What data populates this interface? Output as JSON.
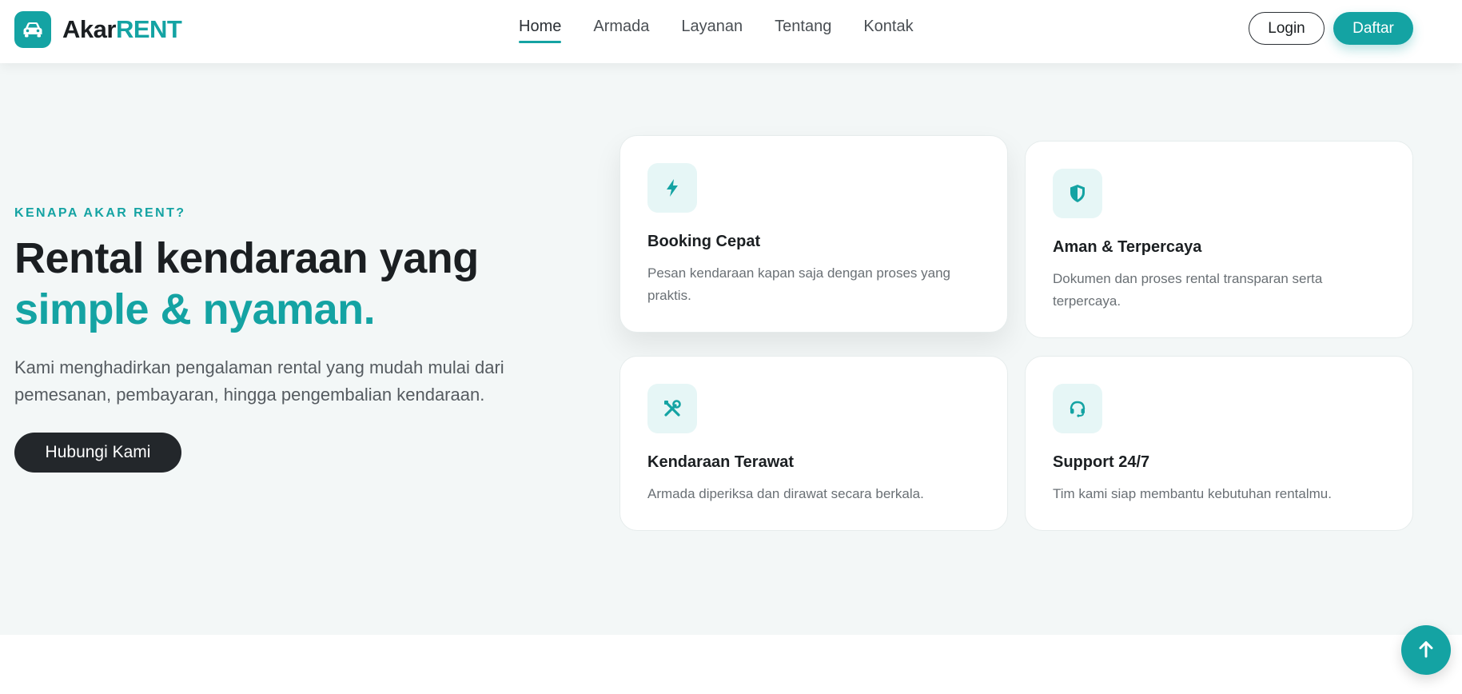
{
  "brand": {
    "name_part1": "Akar",
    "name_part2": "RENT",
    "icon": "car-icon"
  },
  "nav": {
    "items": [
      {
        "label": "Home",
        "active": true
      },
      {
        "label": "Armada",
        "active": false
      },
      {
        "label": "Layanan",
        "active": false
      },
      {
        "label": "Tentang",
        "active": false
      },
      {
        "label": "Kontak",
        "active": false
      }
    ],
    "login_label": "Login",
    "signup_label": "Daftar"
  },
  "hero": {
    "eyebrow": "KENAPA AKAR RENT?",
    "headline_line1": "Rental kendaraan yang",
    "headline_line2": "simple & nyaman.",
    "lead": "Kami menghadirkan pengalaman rental yang mudah mulai dari pemesanan, pembayaran, hingga pengembalian kendaraan.",
    "cta_label": "Hubungi Kami"
  },
  "features": [
    {
      "icon": "lightning-icon",
      "title": "Booking Cepat",
      "desc": "Pesan kendaraan kapan saja dengan proses yang praktis."
    },
    {
      "icon": "shield-icon",
      "title": "Aman & Terpercaya",
      "desc": "Dokumen dan proses rental transparan serta terpercaya."
    },
    {
      "icon": "tools-icon",
      "title": "Kendaraan Terawat",
      "desc": "Armada diperiksa dan dirawat secara berkala."
    },
    {
      "icon": "headset-icon",
      "title": "Support 24/7",
      "desc": "Tim kami siap membantu kebutuhan rentalmu."
    }
  ],
  "colors": {
    "accent": "#14a3a3",
    "dark": "#23272b",
    "hero_bg": "#f3f7f7"
  },
  "scroll_top_icon": "arrow-up-icon"
}
